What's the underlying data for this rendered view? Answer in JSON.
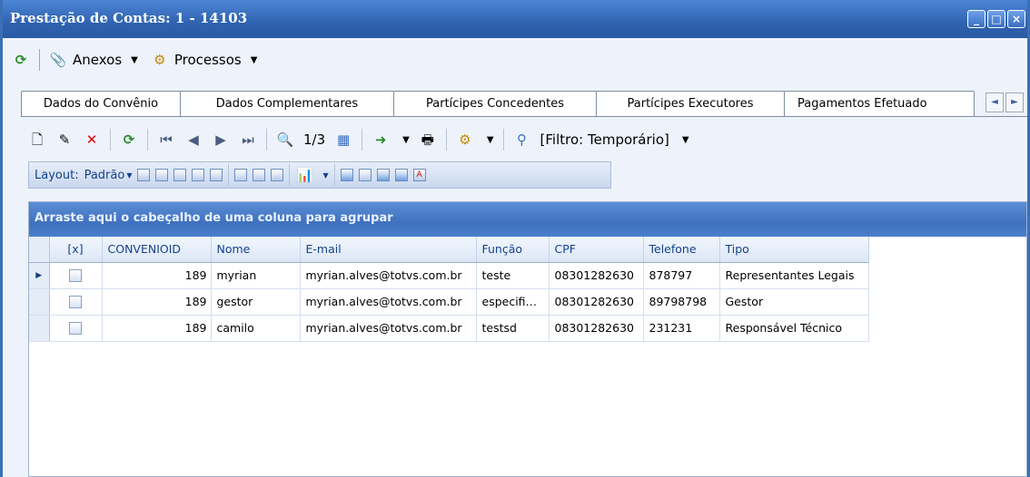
{
  "window": {
    "title": "Prestação de Contas: 1 - 14103"
  },
  "menu": {
    "items": [
      {
        "label": "Anexos"
      },
      {
        "label": "Processos"
      }
    ]
  },
  "tabs": [
    "Dados do Convênio",
    "Dados Complementares",
    "Partícipes Concedentes",
    "Partícipes Executores",
    "Pagamentos Efetuado"
  ],
  "toolbar": {
    "page_counter": "1/3",
    "filter_label": "[Filtro: Temporário]"
  },
  "layout_bar": {
    "layout_label": "Layout:",
    "layout_value": "Padrão"
  },
  "grid": {
    "group_hint": "Arraste aqui o cabeçalho de uma coluna para agrupar",
    "columns": [
      "[x]",
      "CONVENIOID",
      "Nome",
      "E-mail",
      "Função",
      "CPF",
      "Telefone",
      "Tipo"
    ],
    "rows": [
      {
        "conveniooid": "189",
        "nome": "myrian",
        "email": "myrian.alves@totvs.com.br",
        "funcao": "teste",
        "cpf": "08301282630",
        "telefone": "878797",
        "tipo": "Representantes Legais"
      },
      {
        "conveniooid": "189",
        "nome": "gestor",
        "email": "myrian.alves@totvs.com.br",
        "funcao": "especifi…",
        "cpf": "08301282630",
        "telefone": "89798798",
        "tipo": "Gestor"
      },
      {
        "conveniooid": "189",
        "nome": "camilo",
        "email": "myrian.alves@totvs.com.br",
        "funcao": "testsd",
        "cpf": "08301282630",
        "telefone": "231231",
        "tipo": "Responsável Técnico"
      }
    ]
  }
}
